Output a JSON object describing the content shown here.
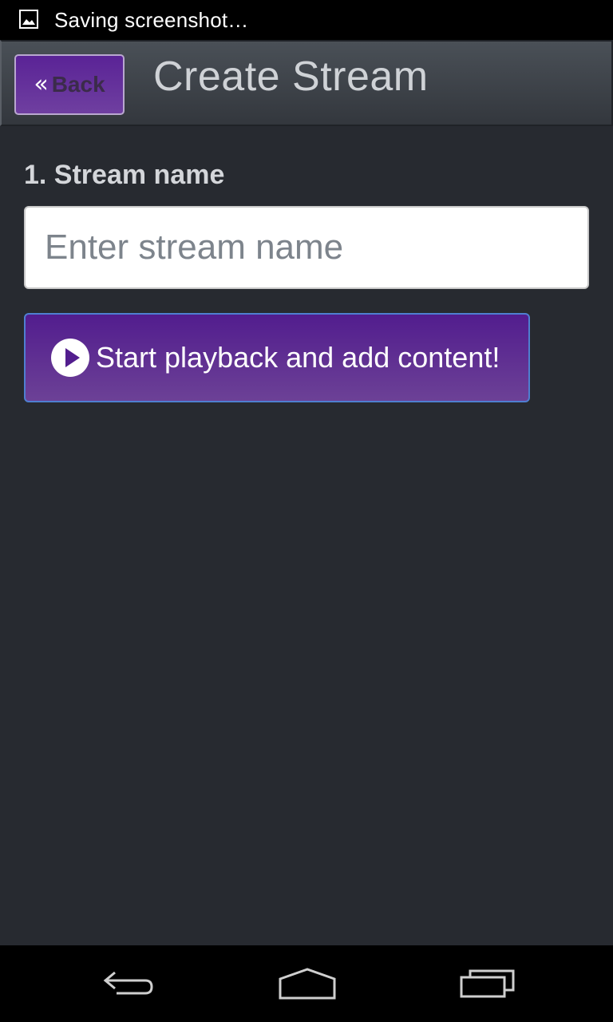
{
  "status_bar": {
    "notification_text": "Saving screenshot…",
    "icon": "image-icon"
  },
  "header": {
    "back_label": "Back",
    "back_icon": "double-chevron-left-icon",
    "title": "Create Stream"
  },
  "form": {
    "stream_name_label": "1. Stream name",
    "stream_name_value": "",
    "stream_name_placeholder": "Enter stream name",
    "start_button_label": "Start playback and add content!",
    "start_button_icon": "play-circle-icon"
  },
  "nav_bar": {
    "buttons": [
      "back-nav-icon",
      "home-nav-icon",
      "recents-nav-icon"
    ]
  },
  "colors": {
    "background": "#272a30",
    "accent_purple": "#521d8e",
    "header": "#3f444a"
  }
}
